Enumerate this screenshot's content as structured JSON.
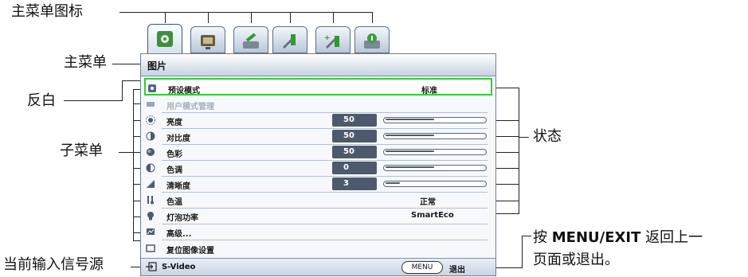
{
  "callouts": {
    "main_menu_icons": "主菜单图标",
    "main_menu": "主菜单",
    "highlight": "反白",
    "submenu": "子菜单",
    "status": "状态",
    "current_input": "当前输入信号源",
    "menu_exit_line1_pre": "按 ",
    "menu_exit_line1_bold": "MENU/EXIT",
    "menu_exit_line1_post": " 返回上一",
    "menu_exit_line2": "页面或退出。"
  },
  "tabs": [
    {
      "icon": "picture-icon",
      "active": true
    },
    {
      "icon": "display-icon",
      "active": false
    },
    {
      "icon": "setup-basic-icon",
      "active": false
    },
    {
      "icon": "system-setup-icon",
      "active": false
    },
    {
      "icon": "system-setup-advanced-icon",
      "active": false
    },
    {
      "icon": "information-icon",
      "active": false
    }
  ],
  "menu": {
    "title": "图片",
    "items": [
      {
        "label": "预设模式",
        "value": "标准",
        "icon": "preset-mode-icon"
      },
      {
        "label": "用户模式管理",
        "icon": "user-mode-icon",
        "disabled": true
      },
      {
        "label": "亮度",
        "number": "50",
        "level": 0.5,
        "icon": "brightness-icon"
      },
      {
        "label": "对比度",
        "number": "50",
        "level": 0.5,
        "icon": "contrast-icon"
      },
      {
        "label": "色彩",
        "number": "50",
        "level": 0.5,
        "icon": "color-icon"
      },
      {
        "label": "色调",
        "number": "0",
        "level": 0.5,
        "icon": "tint-icon"
      },
      {
        "label": "清晰度",
        "number": "3",
        "level": 0.15,
        "icon": "sharpness-icon"
      },
      {
        "label": "色温",
        "value": "正常",
        "icon": "color-temperature-icon"
      },
      {
        "label": "灯泡功率",
        "value": "SmartEco",
        "icon": "lamp-power-icon"
      },
      {
        "label": "高级...",
        "icon": "advanced-icon"
      },
      {
        "label": "复位图像设置",
        "icon": "reset-icon"
      }
    ]
  },
  "footer": {
    "source": "S-Video",
    "menu_button": "MENU",
    "exit": "退出"
  },
  "colors": {
    "highlight_border": "#2fcf2f",
    "number_box": "#4d5a6d",
    "header_gradient_bottom": "#c6d3e2"
  }
}
